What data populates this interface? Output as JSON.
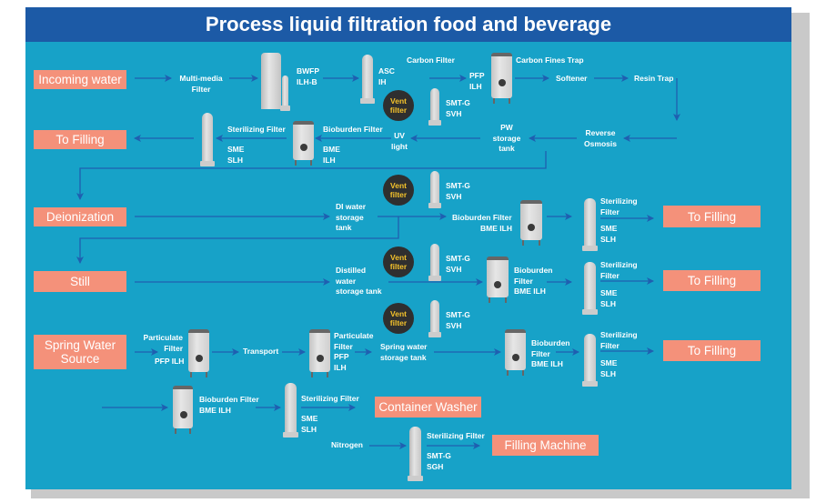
{
  "title": "Process liquid filtration food and beverage",
  "colors": {
    "background": "#17a2c8",
    "title_bar": "#1c5aa6",
    "endpoint_box": "#f4917a",
    "arrow": "#1f5fb0",
    "vent_filter": "#2f2f2f",
    "vent_text": "#f4c22b"
  },
  "endpoints": {
    "incoming_water": "Incoming water",
    "to_filling_1": "To Filling",
    "deionization": "Deionization",
    "still": "Still",
    "spring_water_source": "Spring Water\nSource",
    "to_filling_di": "To Filling",
    "to_filling_still": "To Filling",
    "to_filling_spring": "To Filling",
    "container_washer": "Container Washer",
    "filling_machine": "Filling Machine"
  },
  "vent_filter": "Vent\nfilter",
  "labels": {
    "multimedia": "Multi-media\nFilter",
    "bwfp": "BWFP\nILH-B",
    "asc": "ASC\nIH",
    "carbon_filter": "Carbon Filter",
    "pfp1": "PFP\nILH",
    "carbon_fines": "Carbon Fines Trap",
    "softener": "Softener",
    "resin_trap": "Resin Trap",
    "smtg1": "SMT-G\nSVH",
    "reverse_osmosis": "Reverse\nOsmosis",
    "pw_tank": "PW\nstorage\ntank",
    "uv": "UV\nlight",
    "bio1": "Bioburden Filter",
    "bio1_model": "BME\nILH",
    "ster1": "Sterilizing Filter",
    "ster1_model": "SME\nSLH",
    "smtg2": "SMT-G\nSVH",
    "di_tank": "DI water\nstorage\ntank",
    "bio2": "Bioburden Filter",
    "bio2_model": "BME ILH",
    "ster2": "Sterilizing\nFilter",
    "ster2_model": "SME\nSLH",
    "smtg3": "SMT-G\nSVH",
    "distilled_tank": "Distilled\nwater\nstorage tank",
    "bio3": "Bioburden\nFilter\nBME ILH",
    "ster3": "Sterilizing\nFilter",
    "ster3_model": "SME\nSLH",
    "smtg4": "SMT-G\nSVH",
    "part1": "Particulate\nFilter",
    "part1_model": "PFP ILH",
    "transport": "Transport",
    "part2": "Particulate\nFilter\nPFP\nILH",
    "spring_tank": "Spring water\nstorage tank",
    "bio4": "Bioburden\nFilter\nBME ILH",
    "ster4": "Sterilizing\nFilter",
    "ster4_model": "SME\nSLH",
    "bio5": "Bioburden Filter\nBME ILH",
    "ster5": "Sterilizing Filter",
    "ster5_model": "SME\nSLH",
    "nitrogen": "Nitrogen",
    "ster6": "Sterilizing Filter",
    "ster6_model": "SMT-G\nSGH"
  }
}
